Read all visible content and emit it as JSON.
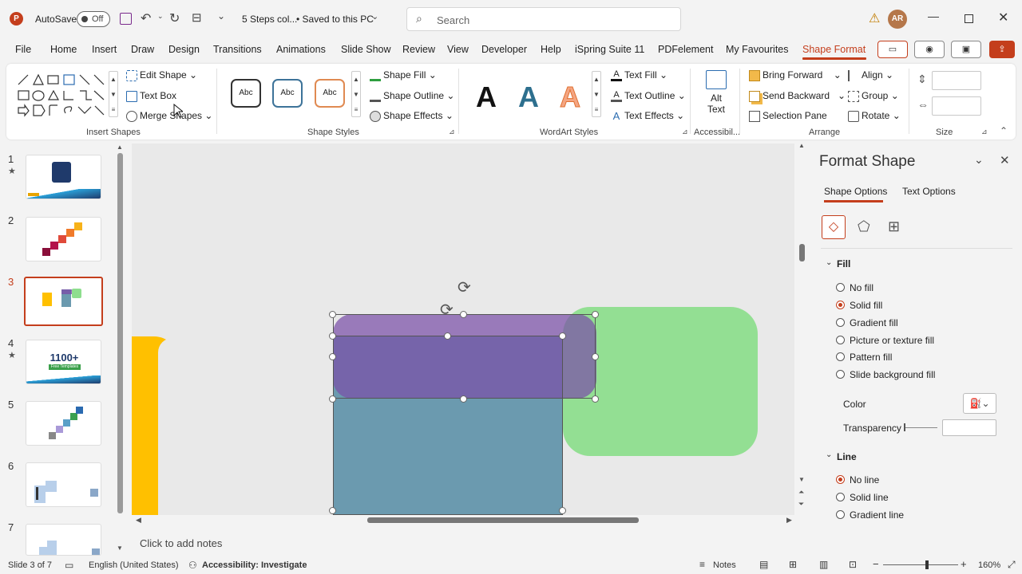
{
  "titlebar": {
    "autosave_label": "AutoSave",
    "autosave_state": "Off",
    "doc_title": "5 Steps col...",
    "save_status": "• Saved to this PC",
    "search_placeholder": "Search",
    "user_initials": "AR"
  },
  "menu": [
    "File",
    "Home",
    "Insert",
    "Draw",
    "Design",
    "Transitions",
    "Animations",
    "Slide Show",
    "Review",
    "View",
    "Developer",
    "Help",
    "iSpring Suite 11",
    "PDFelement",
    "My Favourites",
    "Shape Format"
  ],
  "ribbon": {
    "insert_shapes": {
      "edit_shape": "Edit Shape",
      "text_box": "Text Box",
      "merge_shapes": "Merge Shapes",
      "label": "Insert Shapes"
    },
    "shape_styles": {
      "sample": "Abc",
      "shape_fill": "Shape Fill",
      "shape_outline": "Shape Outline",
      "shape_effects": "Shape Effects",
      "label": "Shape Styles"
    },
    "wordart": {
      "letter": "A",
      "text_fill": "Text Fill",
      "text_outline": "Text Outline",
      "text_effects": "Text Effects",
      "label": "WordArt Styles"
    },
    "accessibility": {
      "alt_text_1": "Alt",
      "alt_text_2": "Text",
      "label": "Accessibil..."
    },
    "arrange": {
      "bring_forward": "Bring Forward",
      "send_backward": "Send Backward",
      "selection_pane": "Selection Pane",
      "align": "Align",
      "group": "Group",
      "rotate": "Rotate",
      "label": "Arrange"
    },
    "size": {
      "label": "Size"
    }
  },
  "slides": [
    "1",
    "2",
    "3",
    "4",
    "5",
    "6",
    "7"
  ],
  "thumb4_text": {
    "big": "1100+",
    "small": "Free Templates"
  },
  "notes_placeholder": "Click to add notes",
  "format_pane": {
    "title": "Format Shape",
    "tabs": [
      "Shape Options",
      "Text Options"
    ],
    "fill_header": "Fill",
    "fill_options": [
      "No fill",
      "Solid fill",
      "Gradient fill",
      "Picture or texture fill",
      "Pattern fill",
      "Slide background fill"
    ],
    "fill_selected": "Solid fill",
    "color_label": "Color",
    "transparency_label": "Transparency",
    "line_header": "Line",
    "line_options": [
      "No line",
      "Solid line",
      "Gradient line"
    ],
    "line_selected": "No line"
  },
  "statusbar": {
    "slide_info": "Slide 3 of 7",
    "language": "English (United States)",
    "accessibility": "Accessibility: Investigate",
    "notes": "Notes",
    "zoom": "160%"
  },
  "colors": {
    "accent": "#c43e1c",
    "purple": "#7a4fa8",
    "teal": "#6b9aaf",
    "green": "#8ede8e",
    "yellow": "#ffc000"
  }
}
